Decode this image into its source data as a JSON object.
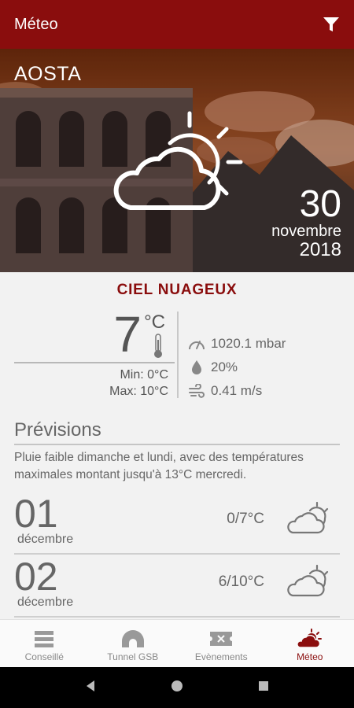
{
  "appbar": {
    "title": "Méteo",
    "filter_icon": "filter-icon"
  },
  "hero": {
    "city": "AOSTA",
    "weather_icon": "partly-cloudy-icon",
    "date": {
      "day": "30",
      "month": "novembre",
      "year": "2018"
    }
  },
  "current": {
    "condition": "CIEL NUAGEUX",
    "temperature": "7",
    "unit": "°C",
    "min": "Min: 0°C",
    "max": "Max: 10°C",
    "pressure": "1020.1 mbar",
    "humidity": "20%",
    "wind": "0.41 m/s"
  },
  "forecast": {
    "title": "Prévisions",
    "text": "Pluie faible dimanche et lundi, avec des températures maximales montant jusqu'à 13°C mercredi.",
    "days": [
      {
        "day": "01",
        "month": "décembre",
        "temps": "0/7°C",
        "icon": "partly-cloudy-icon"
      },
      {
        "day": "02",
        "month": "décembre",
        "temps": "6/10°C",
        "icon": "partly-cloudy-icon"
      }
    ]
  },
  "nav": [
    {
      "label": "Conseillé",
      "icon": "list-icon"
    },
    {
      "label": "Tunnel GSB",
      "icon": "tunnel-icon"
    },
    {
      "label": "Evènements",
      "icon": "ticket-icon"
    },
    {
      "label": "Méteo",
      "icon": "weather-icon",
      "active": true
    }
  ],
  "colors": {
    "brand": "#8a0d0d",
    "text": "#555555",
    "background": "#f2f2f2"
  }
}
